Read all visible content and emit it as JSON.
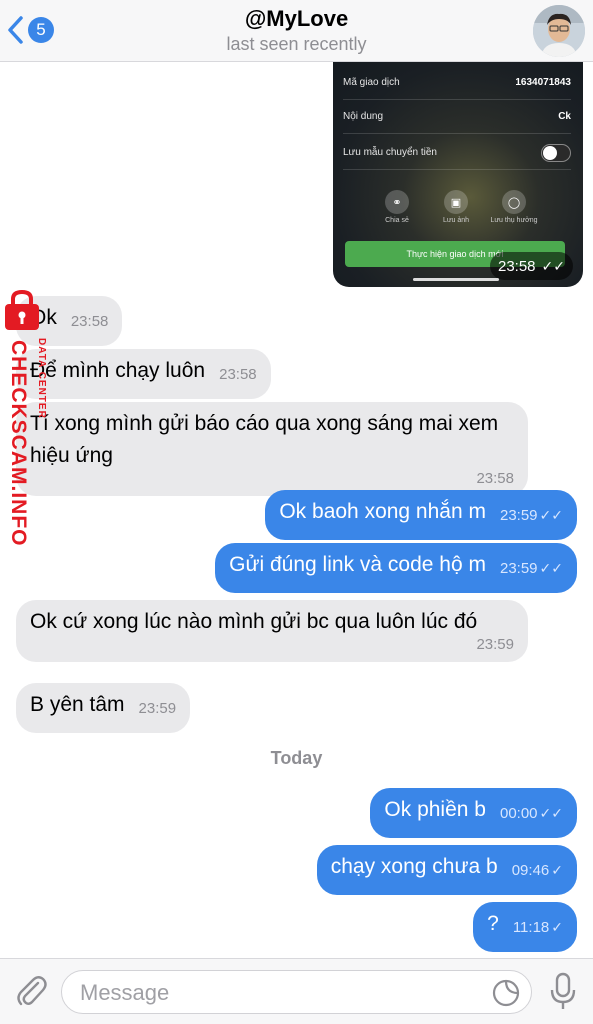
{
  "header": {
    "back_count": "5",
    "title": "@MyLove",
    "subtitle": "last seen recently"
  },
  "photo": {
    "rows": [
      {
        "label": "Mã giao dịch",
        "value": "1634071843"
      },
      {
        "label": "Nội dung",
        "value": "Ck"
      },
      {
        "label": "Lưu mẫu chuyển tiền",
        "value": ""
      }
    ],
    "actions": [
      {
        "label": "Chia sẻ",
        "icon": "share-icon"
      },
      {
        "label": "Lưu ảnh",
        "icon": "camera-icon"
      },
      {
        "label": "Lưu thụ hưởng",
        "icon": "person-icon"
      }
    ],
    "cta": "Thực hiện giao dịch mới",
    "time": "23:58"
  },
  "messages": [
    {
      "dir": "in",
      "text": "Ok",
      "time": "23:58"
    },
    {
      "dir": "in",
      "text": "Để mình chạy luôn",
      "time": "23:58"
    },
    {
      "dir": "in",
      "text": "Tí xong mình gửi báo cáo qua xong sáng mai xem hiệu ứng",
      "time": "23:58"
    },
    {
      "dir": "out",
      "text": "Ok baoh xong nhắn m",
      "time": "23:59"
    },
    {
      "dir": "out",
      "text": "Gửi đúng link và code hộ m",
      "time": "23:59"
    },
    {
      "dir": "in",
      "text": "Ok cứ xong lúc nào mình gửi bc qua luôn lúc đó",
      "time": "23:59"
    },
    {
      "dir": "in",
      "text": "B yên tâm",
      "time": "23:59"
    },
    {
      "dir": "out",
      "text": "Ok phiền b",
      "time": "00:00"
    },
    {
      "dir": "out",
      "text": "chạy xong chưa b",
      "time": "09:46"
    },
    {
      "dir": "out",
      "text": "?",
      "time": "11:18"
    }
  ],
  "date_separator": "Today",
  "watermark": {
    "main": "CHECKSCAM.INFO",
    "sub": "DATA CENTER"
  },
  "input": {
    "placeholder": "Message"
  },
  "colors": {
    "outgoing": "#3a86e8",
    "incoming": "#e9e9eb",
    "watermark": "#e31b23"
  }
}
